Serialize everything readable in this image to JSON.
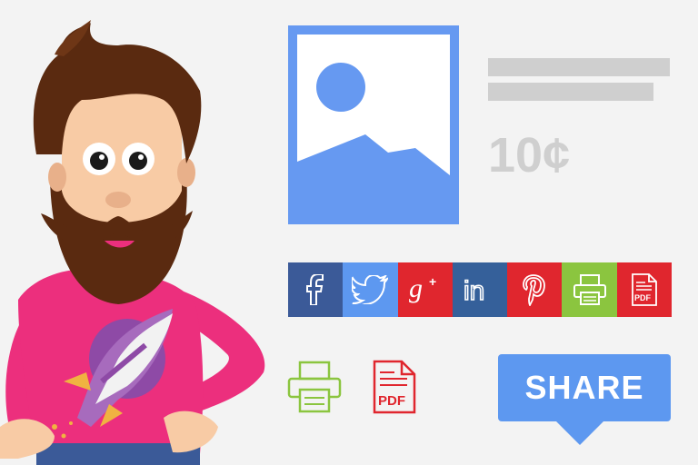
{
  "product": {
    "price": "10¢"
  },
  "social": {
    "buttons": [
      {
        "name": "facebook",
        "icon": "facebook-icon",
        "color": "#3b5a98"
      },
      {
        "name": "twitter",
        "icon": "twitter-icon",
        "color": "#5d98f0"
      },
      {
        "name": "google-plus",
        "icon": "google-plus-icon",
        "color": "#e0262e"
      },
      {
        "name": "linkedin",
        "icon": "linkedin-icon",
        "color": "#35609a"
      },
      {
        "name": "pinterest",
        "icon": "pinterest-icon",
        "color": "#e0262e"
      },
      {
        "name": "print",
        "icon": "printer-icon",
        "color": "#8bc53f"
      },
      {
        "name": "pdf",
        "icon": "pdf-icon",
        "color": "#e0262e"
      }
    ]
  },
  "print_icon_label": "",
  "pdf": {
    "label": "PDF"
  },
  "share": {
    "label": "SHARE"
  },
  "colors": {
    "accent_blue": "#5d98f0",
    "pink_shirt": "#ec2f7d",
    "green": "#8bc53f",
    "red": "#e0262e"
  }
}
